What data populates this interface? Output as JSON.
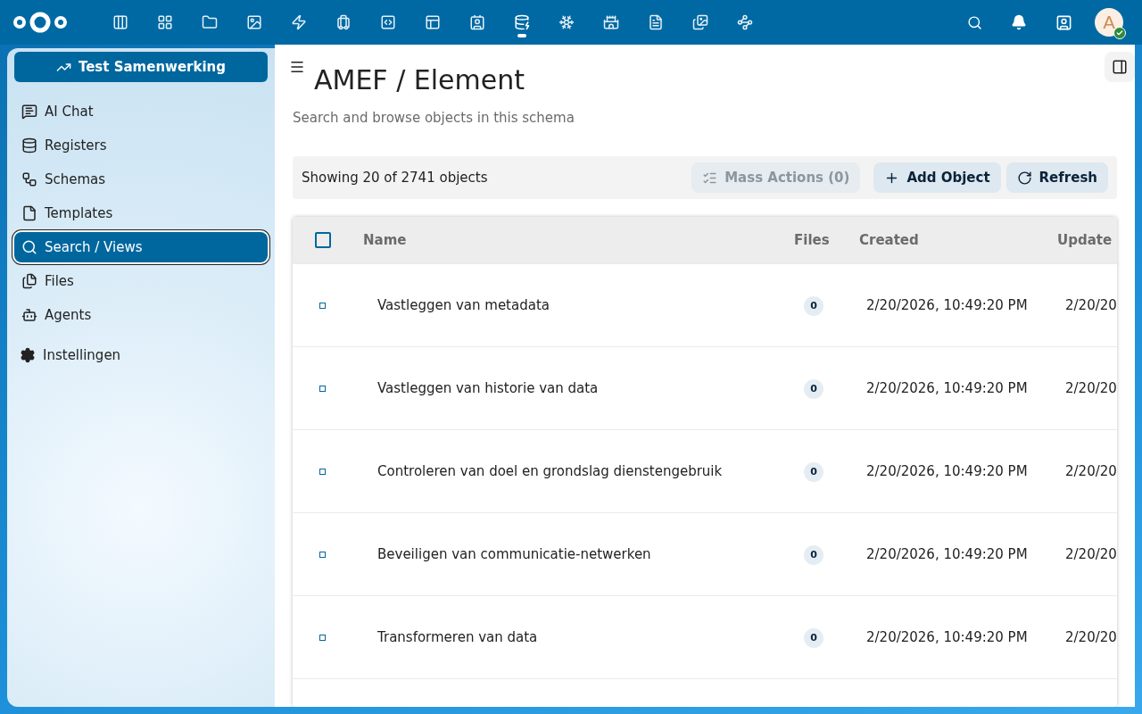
{
  "topbar": {
    "apps": [
      {
        "selected": false
      },
      {
        "selected": false
      },
      {
        "selected": false
      },
      {
        "selected": false
      },
      {
        "selected": false
      },
      {
        "selected": false
      },
      {
        "selected": false
      },
      {
        "selected": false
      },
      {
        "selected": false
      },
      {
        "selected": true
      },
      {
        "selected": false
      },
      {
        "selected": false
      },
      {
        "selected": false
      },
      {
        "selected": false
      },
      {
        "selected": false
      }
    ],
    "avatar": {
      "initial": "A",
      "online": true
    }
  },
  "sidebar": {
    "header_button": "Test Samenwerking",
    "items": [
      {
        "label": "AI Chat",
        "selected": false
      },
      {
        "label": "Registers",
        "selected": false
      },
      {
        "label": "Schemas",
        "selected": false
      },
      {
        "label": "Templates",
        "selected": false
      },
      {
        "label": "Search / Views",
        "selected": true
      },
      {
        "label": "Files",
        "selected": false
      },
      {
        "label": "Agents",
        "selected": false
      }
    ],
    "settings": "Instellingen"
  },
  "page": {
    "title": "AMEF / Element",
    "subtitle": "Search and browse objects in this schema"
  },
  "toolbar": {
    "count": "Showing 20 of 2741 objects",
    "buttons": [
      {
        "label": "Mass Actions (0)",
        "disabled": true
      },
      {
        "label": "Add Object",
        "disabled": false
      },
      {
        "label": "Refresh",
        "disabled": false
      }
    ]
  },
  "table": {
    "all_checked": false,
    "columns": [
      "Name",
      "Files",
      "Created",
      "Update"
    ],
    "rows": [
      {
        "checked": false,
        "name": "Vastleggen van metadata",
        "files": "0",
        "created": "2/20/2026, 10:49:20 PM",
        "updated": "2/20/20"
      },
      {
        "checked": false,
        "name": "Vastleggen van historie van data",
        "files": "0",
        "created": "2/20/2026, 10:49:20 PM",
        "updated": "2/20/20"
      },
      {
        "checked": false,
        "name": "Controleren van doel en grondslag dienstengebruik",
        "files": "0",
        "created": "2/20/2026, 10:49:20 PM",
        "updated": "2/20/20"
      },
      {
        "checked": false,
        "name": "Beveiligen van communicatie-netwerken",
        "files": "0",
        "created": "2/20/2026, 10:49:20 PM",
        "updated": "2/20/20"
      },
      {
        "checked": false,
        "name": "Transformeren van data",
        "files": "0",
        "created": "2/20/2026, 10:49:20 PM",
        "updated": "2/20/20"
      }
    ]
  }
}
